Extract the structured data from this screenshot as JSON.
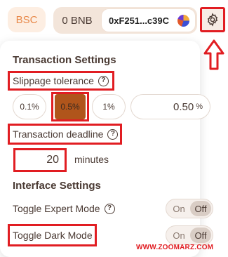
{
  "header": {
    "network_label": "BSC",
    "balance": "0 BNB",
    "wallet_address": "0xF251...c39C"
  },
  "transaction_settings": {
    "title": "Transaction Settings",
    "slippage_label": "Slippage tolerance",
    "slippage_options": [
      "0.1%",
      "0.5%",
      "1%"
    ],
    "slippage_selected": "0.5%",
    "slippage_custom_value": "0.50",
    "slippage_custom_unit": "%",
    "deadline_label": "Transaction deadline",
    "deadline_value": "20",
    "deadline_unit": "minutes"
  },
  "interface_settings": {
    "title": "Interface Settings",
    "expert_mode_label": "Toggle Expert Mode",
    "dark_mode_label": "Toggle Dark Mode",
    "toggle_on_label": "On",
    "toggle_off_label": "Off",
    "expert_mode_state": "Off",
    "dark_mode_state": "Off"
  },
  "help_icon_glyph": "?",
  "watermark": "WWW.ZOOMARZ.COM",
  "colors": {
    "accent": "#e8894a",
    "selected_option": "#b0551b",
    "annotation_red": "#e11d22",
    "text": "#4a3a33"
  },
  "icons": [
    "gear-icon",
    "help-circle-icon",
    "wallet-avatar-icon",
    "up-arrow-icon"
  ]
}
